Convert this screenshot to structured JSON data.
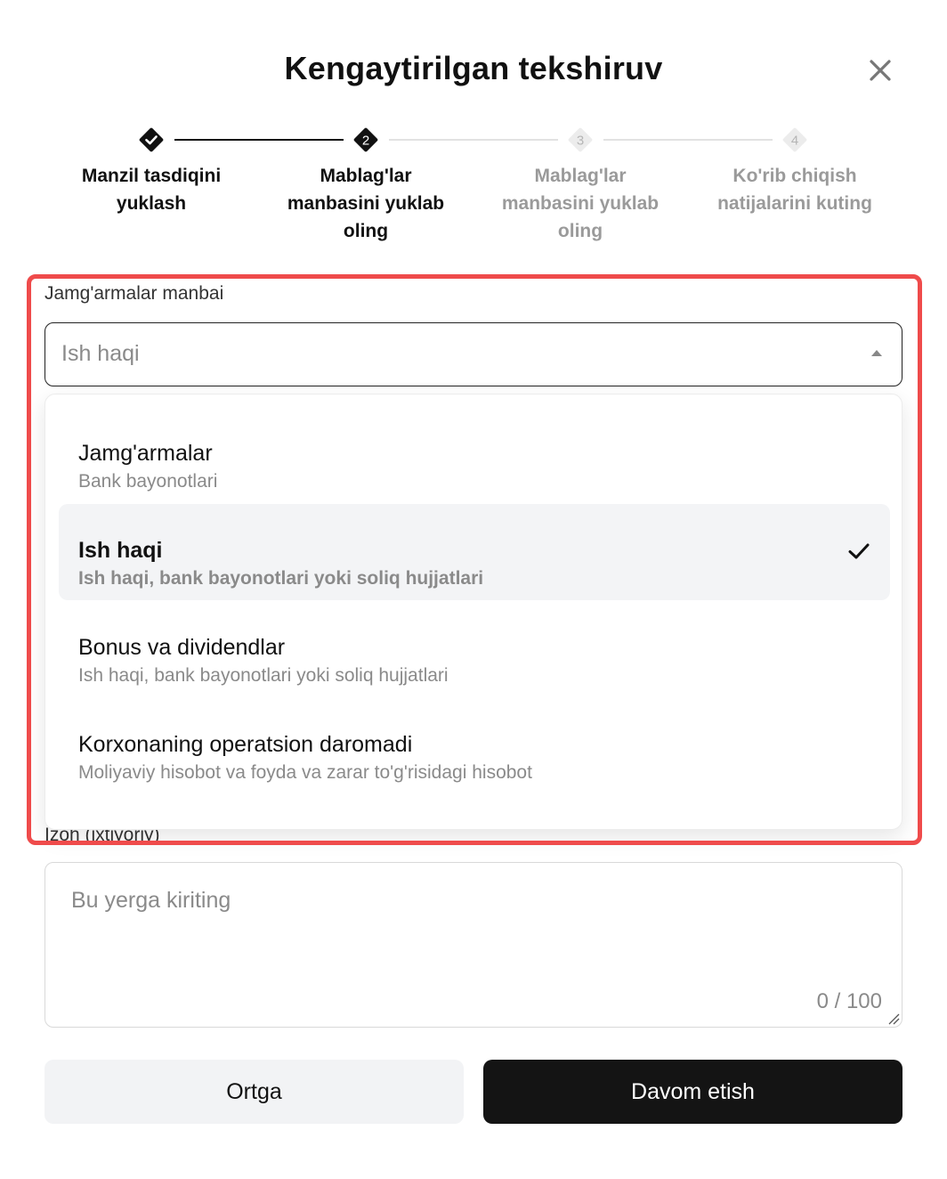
{
  "dialog": {
    "title": "Kengaytirilgan tekshiruv",
    "close_icon": "close-icon"
  },
  "stepper": {
    "steps": [
      {
        "label": "Manzil tasdiqini yuklash",
        "state": "completed",
        "marker": "check-icon"
      },
      {
        "label": "Mablag'lar manbasini yuklab oling",
        "state": "active",
        "marker": "2"
      },
      {
        "label": "Mablag'lar manbasini yuklab oling",
        "state": "upcoming",
        "marker": "3"
      },
      {
        "label": "Ko'rib chiqish natijalarini kuting",
        "state": "upcoming",
        "marker": "4"
      }
    ]
  },
  "source_field": {
    "label": "Jamg'armalar manbai",
    "value": "Ish haqi",
    "caret_icon": "caret-up-icon",
    "options": [
      {
        "title": "Jamg'armalar",
        "subtitle": "Bank bayonotlari",
        "selected": false
      },
      {
        "title": "Ish haqi",
        "subtitle": "Ish haqi, bank bayonotlari yoki soliq hujjatlari",
        "selected": true
      },
      {
        "title": "Bonus va dividendlar",
        "subtitle": "Ish haqi, bank bayonotlari yoki soliq hujjatlari",
        "selected": false
      },
      {
        "title": "Korxonaning operatsion daromadi",
        "subtitle": "Moliyaviy hisobot va foyda va zarar to'g'risidagi hisobot",
        "selected": false
      }
    ]
  },
  "note_field": {
    "label": "Izoh (ixtiyoriy)",
    "placeholder": "Bu yerga kiriting",
    "counter": "0 / 100"
  },
  "actions": {
    "back_label": "Ortga",
    "next_label": "Davom etish"
  },
  "colors": {
    "highlight": "#ef4b4b",
    "primary_button": "#141414",
    "secondary_button": "#f2f3f5",
    "selected_option": "#f3f4f6"
  }
}
